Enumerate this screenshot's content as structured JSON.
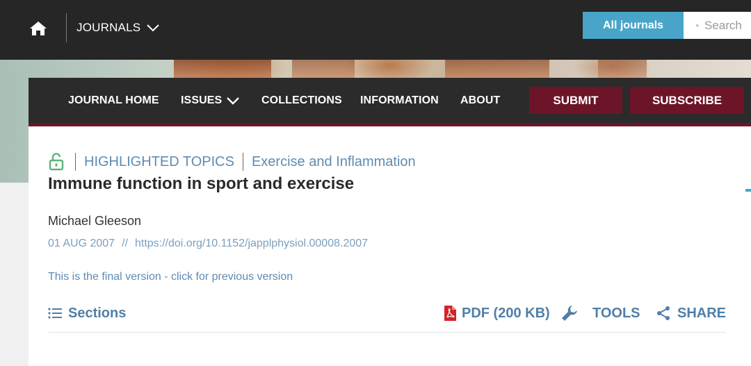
{
  "topbar": {
    "journals_label": "JOURNALS",
    "all_journals_label": "All journals",
    "search_placeholder": "Search"
  },
  "journal_nav": {
    "items": [
      "JOURNAL HOME",
      "ISSUES",
      "COLLECTIONS",
      "INFORMATION",
      "ABOUT"
    ],
    "submit_label": "SUBMIT",
    "subscribe_label": "SUBSCRIBE"
  },
  "article": {
    "topic_category": "HIGHLIGHTED TOPICS",
    "topic_name": "Exercise and Inflammation",
    "title": "Immune function in sport and exercise",
    "author": "Michael Gleeson",
    "date": "01 AUG 2007",
    "date_separator": "//",
    "doi": "https://doi.org/10.1152/japplphysiol.00008.2007",
    "version_note": "This is the final version - click for previous version"
  },
  "actions": {
    "sections_label": "Sections",
    "pdf_label": "PDF (200 KB)",
    "tools_label": "TOOLS",
    "share_label": "SHARE"
  },
  "colors": {
    "topbar_bg": "#262626",
    "accent_blue": "#48a5c9",
    "burgundy": "#6d1528",
    "link_blue": "#5e8bb1",
    "pdf_red": "#d2232a",
    "open_access_green": "#5ab57a"
  },
  "icons": {
    "home": "home-icon",
    "journals_chevron": "chevron-down-icon",
    "search": "search-icon",
    "open_access": "open-access-lock-icon",
    "sections": "list-icon",
    "pdf": "pdf-file-icon",
    "tools": "wrench-icon",
    "share": "share-icon"
  }
}
